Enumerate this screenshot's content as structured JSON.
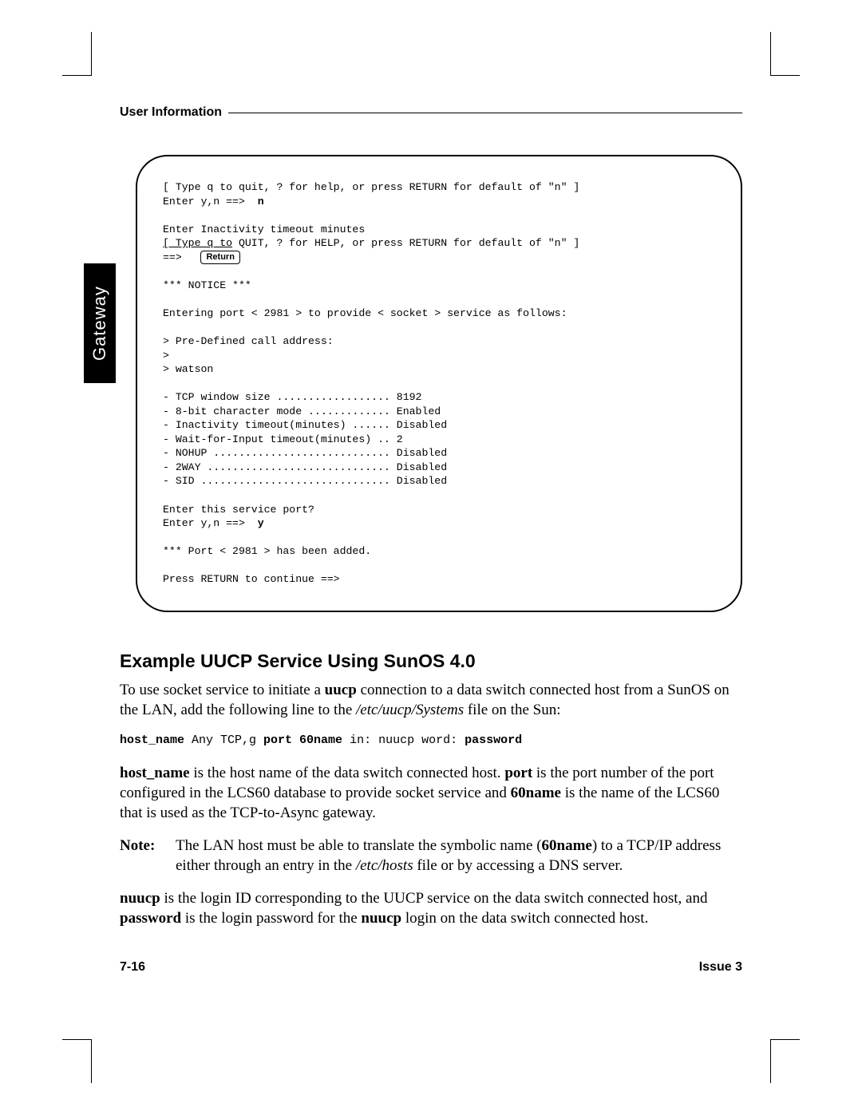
{
  "running_head": "User Information",
  "side_tab": "Gateway",
  "terminal": {
    "l1": "[ Type q to quit, ? for help, or press RETURN for default of \"n\" ]",
    "l2a": "Enter y,n ==>  ",
    "l2b": "n",
    "blk1_l1": "Enter Inactivity timeout minutes",
    "blk1_l2": "[ Type q to QUIT, ? for HELP, or press RETURN for default of \"n\" ]",
    "blk1_l3a": "==>   ",
    "key_return": "Return",
    "blk2_l1": "*** NOTICE ***",
    "blk3_l1": "Entering port < 2981 > to provide < socket > service as follows:",
    "blk4_l1": "> Pre-Defined call address:",
    "blk4_l2": ">",
    "blk4_l3": "> watson",
    "blk5_l1": "- TCP window size .................. 8192",
    "blk5_l2": "- 8-bit character mode ............. Enabled",
    "blk5_l3": "- Inactivity timeout(minutes) ...... Disabled",
    "blk5_l4": "- Wait-for-Input timeout(minutes) .. 2",
    "blk5_l5": "- NOHUP ............................ Disabled",
    "blk5_l6": "- 2WAY ............................. Disabled",
    "blk5_l7": "- SID .............................. Disabled",
    "blk6_l1": "Enter this service port?",
    "blk6_l2a": "Enter y,n ==>  ",
    "blk6_l2b": "y",
    "blk7_l1": "*** Port < 2981 > has been added.",
    "blk8_l1": "Press RETURN to continue ==>"
  },
  "section_heading": "Example UUCP Service Using SunOS 4.0",
  "para1": {
    "t1": "To use socket service to initiate a ",
    "b1": "uucp",
    "t2": " connection to a data switch connected host from a SunOS on the LAN, add the following line to the ",
    "i1": "/etc/uucp/Systems",
    "t3": " file on the Sun:"
  },
  "codeline": {
    "c1": "host_name",
    "c2": " Any TCP,g ",
    "c3": "port 60name",
    "c4": " in: nuucp word: ",
    "c5": "password"
  },
  "para2": {
    "b1": "host_name",
    "t1": " is the host name of the data switch connected host.  ",
    "b2": "port",
    "t2": " is the port number of the port configured in the LCS60 database to provide socket service and ",
    "b3": "60name",
    "t3": " is the name of the LCS60 that is used as the TCP-to-Async gateway."
  },
  "note": {
    "label": "Note:",
    "t1": "The LAN host must be able to translate the symbolic name (",
    "b1": "60name",
    "t2": ") to a TCP/IP address either through an entry in the ",
    "i1": "/etc/hosts",
    "t3": " file or by accessing a DNS server."
  },
  "para3": {
    "b1": "nuucp",
    "t1": " is the login ID corresponding to the UUCP service on the data switch connected host, and ",
    "b2": "password",
    "t2": " is the login password for the ",
    "b3": "nuucp",
    "t3": " login on the data switch connected host."
  },
  "footer": {
    "left": "7-16",
    "right": "Issue 3"
  }
}
